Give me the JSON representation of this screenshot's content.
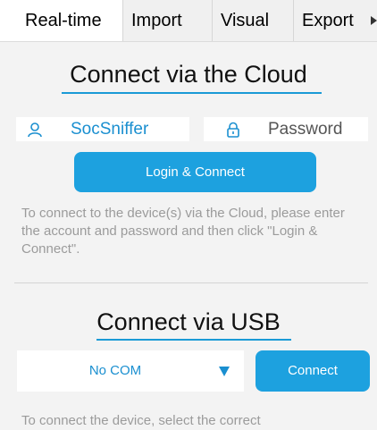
{
  "tabs": {
    "realtime": "Real-time",
    "import": "Import",
    "visual": "Visual",
    "export": "Export"
  },
  "cloud": {
    "title": "Connect via the Cloud",
    "username_value": "SocSniffer",
    "password_placeholder": "Password",
    "login_button": "Login & Connect",
    "help": "To connect to the device(s) via the Cloud, please enter the account and password and then click \"Login & Connect\"."
  },
  "usb": {
    "title": "Connect via USB",
    "com_selected": "No COM",
    "connect_button": "Connect",
    "help": "To connect the device, select the correct"
  },
  "colors": {
    "accent": "#1da1df",
    "accent_text": "#1a8fd0",
    "background": "#f3f3f3",
    "help_text": "#9b9b9b"
  },
  "icons": {
    "username": "user-icon",
    "password": "lock-icon",
    "com_dropdown": "triangle-down-icon",
    "tab_overflow": "chevron-right-icon"
  }
}
